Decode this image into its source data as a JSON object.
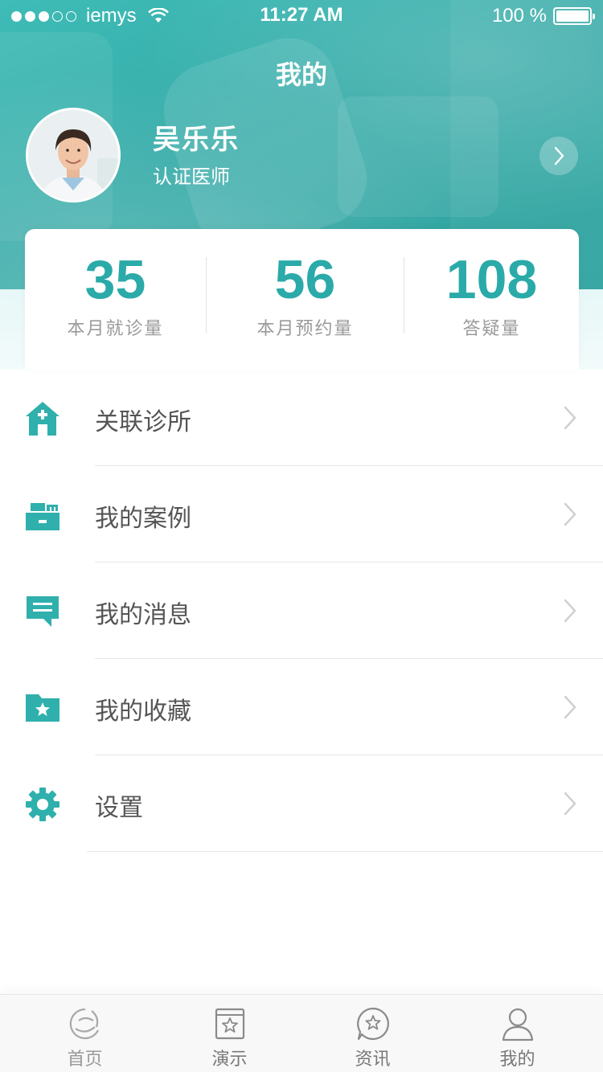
{
  "status_bar": {
    "carrier": "iemys",
    "time": "11:27 AM",
    "battery_text": "100 %",
    "signal_bars_filled": 3,
    "signal_bars_total": 5
  },
  "header": {
    "title": "我的"
  },
  "profile": {
    "name": "吴乐乐",
    "role": "认证医师"
  },
  "stats": [
    {
      "value": "35",
      "label": "本月就诊量"
    },
    {
      "value": "56",
      "label": "本月预约量"
    },
    {
      "value": "108",
      "label": "答疑量"
    }
  ],
  "menu": [
    {
      "label": "关联诊所",
      "icon": "clinic-icon"
    },
    {
      "label": "我的案例",
      "icon": "case-icon"
    },
    {
      "label": "我的消息",
      "icon": "message-icon"
    },
    {
      "label": "我的收藏",
      "icon": "favorites-folder-icon"
    },
    {
      "label": "设置",
      "icon": "gear-icon"
    }
  ],
  "tabbar": {
    "tabs": [
      {
        "label": "首页",
        "icon": "home-logo-icon"
      },
      {
        "label": "演示",
        "icon": "demo-icon"
      },
      {
        "label": "资讯",
        "icon": "news-icon"
      },
      {
        "label": "我的",
        "icon": "user-icon"
      }
    ]
  },
  "colors": {
    "accent": "#2aaaa9",
    "hero": "#3bb3af",
    "text": "#555555",
    "muted": "#999999"
  }
}
